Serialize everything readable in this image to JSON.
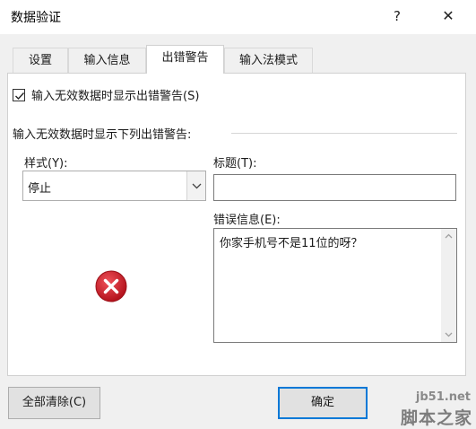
{
  "window": {
    "title": "数据验证",
    "help_label": "?",
    "close_label": "✕"
  },
  "tabs": [
    {
      "label": "设置",
      "active": false
    },
    {
      "label": "输入信息",
      "active": false
    },
    {
      "label": "出错警告",
      "active": true
    },
    {
      "label": "输入法模式",
      "active": false
    }
  ],
  "error_alert": {
    "show_alert_label": "输入无效数据时显示出错警告(S)",
    "show_alert_checked": true,
    "group_label": "输入无效数据时显示下列出错警告:",
    "style_label": "样式(Y):",
    "style_value": "停止",
    "title_label": "标题(T):",
    "title_value": "",
    "message_label": "错误信息(E):",
    "message_value": "你家手机号不是11位的呀？",
    "style_icon": "error-stop-icon",
    "icon_color": "#c7202b"
  },
  "buttons": {
    "clear_all": "全部清除(C)",
    "ok": "确定"
  },
  "watermark": {
    "url": "jb51.net",
    "brand": "脚本之家"
  },
  "colors": {
    "accent": "#0078d7"
  }
}
